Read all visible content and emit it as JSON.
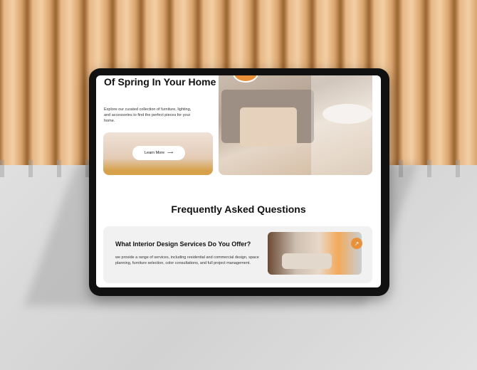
{
  "hero": {
    "title": "Of Spring In Your Home",
    "description": "Explore our curated collection of furniture, lighting, and accessories to find the perfect pieces for your home.",
    "learn_more": "Learn More",
    "arrow": "⟶"
  },
  "faq": {
    "heading": "Frequently Asked Questions",
    "items": [
      {
        "question": "What Interior Design Services Do You Offer?",
        "answer": "we provide a range of services, including residential and commercial design, space planning, furniture selection, color consultations, and full project management.",
        "icon": "↗"
      }
    ]
  },
  "colors": {
    "accent": "#e8913a"
  }
}
